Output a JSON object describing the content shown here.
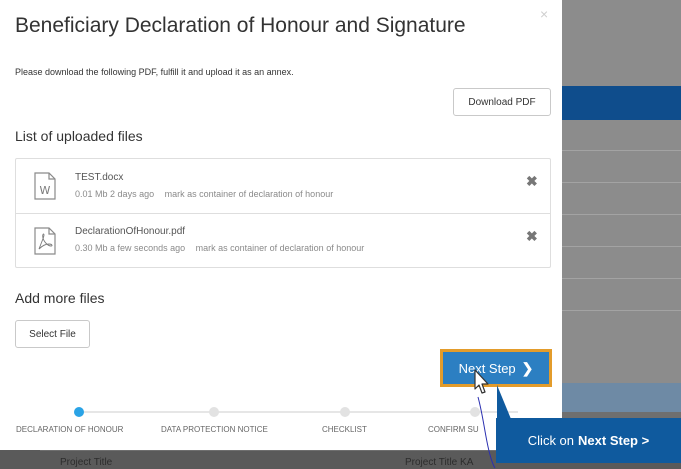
{
  "modal": {
    "title": "Beneficiary Declaration of Honour and Signature",
    "close_icon": "×",
    "instruction": "Please download the following PDF, fulfill it and upload it as an annex.",
    "download_label": "Download PDF",
    "uploaded_heading": "List of uploaded files",
    "files": [
      {
        "icon": "word-document-icon",
        "name": "TEST.docx",
        "size": "0.01 Mb",
        "time": "2 days ago",
        "link": "mark as container of declaration of honour",
        "remove": "✖"
      },
      {
        "icon": "pdf-document-icon",
        "name": "DeclarationOfHonour.pdf",
        "size": "0.30 Mb",
        "time": "a few seconds ago",
        "link": "mark as container of declaration of honour",
        "remove": "✖"
      }
    ],
    "add_more_heading": "Add more files",
    "select_file_label": "Select File",
    "next_step_label": "Next Step",
    "next_step_chevron": "❯"
  },
  "stepper": {
    "steps": [
      {
        "label": "DECLARATION OF HONOUR",
        "active": true
      },
      {
        "label": "DATA PROTECTION NOTICE",
        "active": false
      },
      {
        "label": "CHECKLIST",
        "active": false
      },
      {
        "label": "CONFIRM SU",
        "active": false
      }
    ]
  },
  "tooltip": {
    "prefix": "Click on",
    "bold": "Next Step >"
  },
  "background": {
    "col1": "Project Title",
    "col2": "Project Title KA"
  },
  "colors": {
    "accent_blue": "#2c7fc2",
    "highlight_orange": "#e39c2b",
    "tooltip_blue": "#0f5a9e",
    "active_step": "#2aa3e6"
  }
}
